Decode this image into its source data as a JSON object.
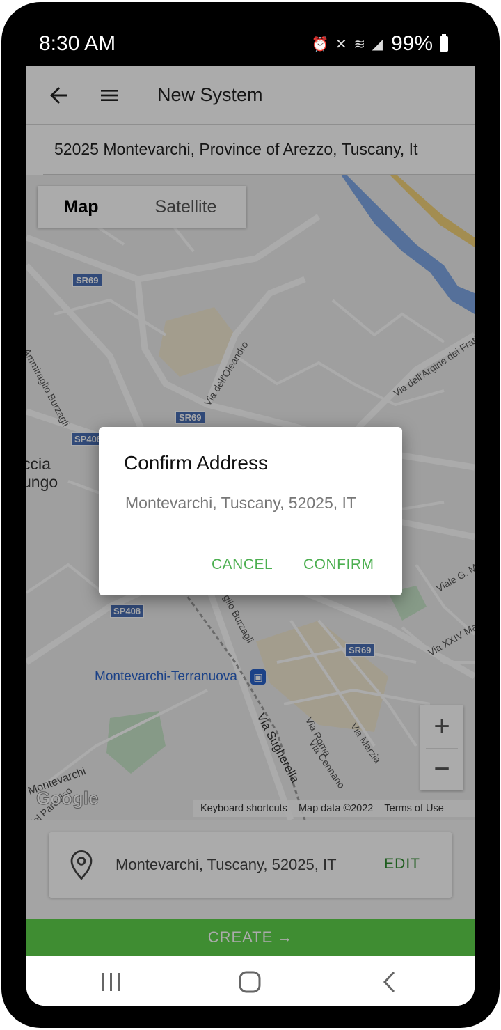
{
  "status_bar": {
    "time": "8:30 AM",
    "icons": "⏰ ✕ ≋ ◢",
    "battery": "99%"
  },
  "app_bar": {
    "title": "New System",
    "back_icon": "arrow-left-icon",
    "menu_icon": "hamburger-menu-icon"
  },
  "address_search": {
    "value": "52025 Montevarchi, Province of Arezzo, Tuscany, It"
  },
  "map": {
    "tabs": [
      {
        "label": "Map",
        "active": true
      },
      {
        "label": "Satellite",
        "active": false
      }
    ],
    "road_badges": [
      "SR69",
      "SR69",
      "SP408",
      "SP408",
      "SR69"
    ],
    "street_labels": [
      "Via Ammiraglio Burzagli",
      "Via dell'Oleandro",
      "Via dell'Argine dei Frati",
      "Viale G. M",
      "Via XXIV Ma",
      "Via Roma",
      "Via Cennano",
      "Via Marzia",
      "Via Sugherella",
      "glio Burzagli",
      "Montevarchi",
      "del Paradiso"
    ],
    "town_labels": [
      "ccia",
      "ungo"
    ],
    "poi_label": "Montevarchi-Terranuova",
    "zoom_in": "+",
    "zoom_out": "−",
    "logo": "Google",
    "footer": {
      "shortcuts": "Keyboard shortcuts",
      "map_data": "Map data ©2022",
      "terms": "Terms of Use"
    },
    "colors": {
      "water": "#7fa8e6",
      "highway": "#f3d27a",
      "park": "#c8e6c9"
    }
  },
  "location_card": {
    "address": "Montevarchi, Tuscany, 52025, IT",
    "edit_label": "EDIT",
    "icon": "map-pin-icon"
  },
  "create_button": {
    "label": "CREATE",
    "arrow": "→",
    "color": "#5fd24b"
  },
  "dialog": {
    "title": "Confirm Address",
    "message": "Montevarchi, Tuscany, 52025, IT",
    "cancel_label": "CANCEL",
    "confirm_label": "CONFIRM",
    "accent": "#4caf50"
  },
  "nav_bar": {
    "recents_icon": "recents-icon",
    "home_icon": "home-icon",
    "back_icon": "back-chevron-icon"
  }
}
